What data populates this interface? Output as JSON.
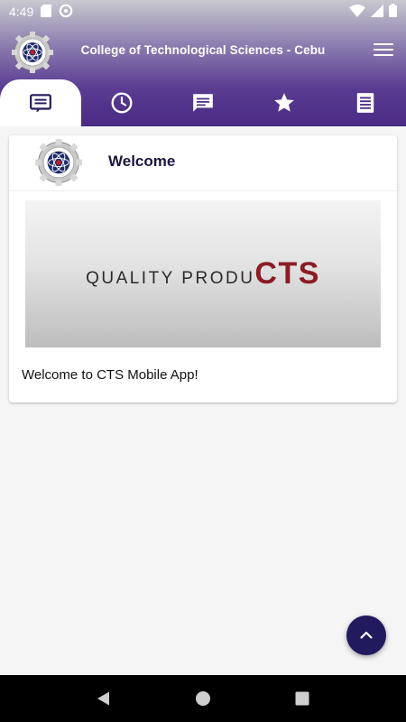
{
  "status_bar": {
    "time": "4:49",
    "left_icons": [
      "sd-card-icon",
      "sync-icon"
    ],
    "right_icons": [
      "wifi-icon",
      "cellular-icon",
      "battery-icon"
    ]
  },
  "app_bar": {
    "title": "College of Technological Sciences - Cebu",
    "logo_icon": "cts-gear-logo",
    "menu_icon": "hamburger-menu-icon"
  },
  "tabs": [
    {
      "id": "news",
      "icon": "news-feed-icon",
      "active": true
    },
    {
      "id": "schedule",
      "icon": "clock-icon",
      "active": false
    },
    {
      "id": "messages",
      "icon": "chat-icon",
      "active": false
    },
    {
      "id": "favorites",
      "icon": "star-icon",
      "active": false
    },
    {
      "id": "notes",
      "icon": "notes-icon",
      "active": false
    }
  ],
  "card": {
    "title": "Welcome",
    "banner": {
      "text_part1": "QUALITY PRODU",
      "text_part2": "CTS"
    },
    "body": "Welcome to CTS Mobile App!"
  },
  "fab": {
    "icon": "chevron-up-icon"
  },
  "nav_bar": {
    "icons": [
      "back-icon",
      "home-icon",
      "recents-icon"
    ]
  },
  "colors": {
    "header_dark": "#4a2a85",
    "fab": "#221a5e",
    "card_title": "#1c1540",
    "banner_accent": "#8b1c24"
  }
}
